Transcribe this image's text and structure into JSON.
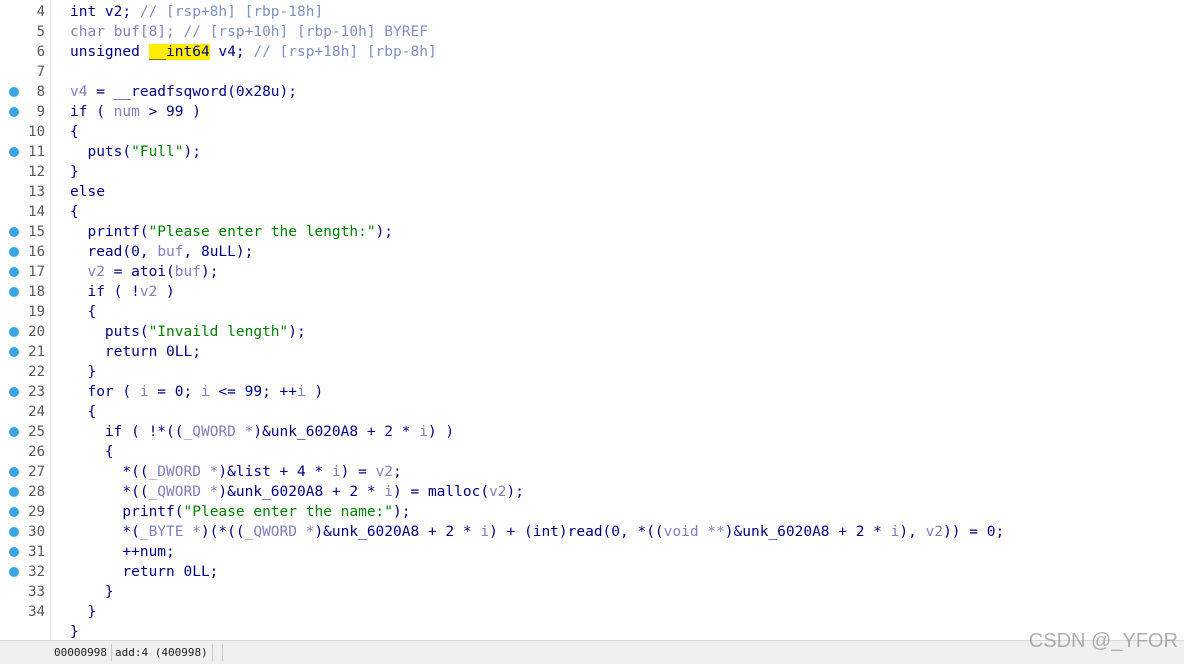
{
  "editor": {
    "lines": [
      {
        "num": "4",
        "bp": false,
        "segs": [
          [
            "int v2; ",
            ""
          ],
          [
            "// [rsp+8h] [rbp-18h]",
            "s-c"
          ]
        ]
      },
      {
        "num": "5",
        "bp": false,
        "segs": [
          [
            "char buf[8]; ",
            "s-v"
          ],
          [
            "// [rsp+10h] [rbp-10h] BYREF",
            "s-c"
          ]
        ]
      },
      {
        "num": "6",
        "bp": false,
        "segs": [
          [
            "unsigned ",
            ""
          ],
          [
            "__int64",
            "s-hl"
          ],
          [
            " v4; ",
            ""
          ],
          [
            "// [rsp+18h] [rbp-8h]",
            "s-c"
          ]
        ]
      },
      {
        "num": "7",
        "bp": false,
        "segs": []
      },
      {
        "num": "8",
        "bp": true,
        "segs": [
          [
            "v4",
            "s-v"
          ],
          [
            " = __readfsqword(0x28u);",
            ""
          ]
        ]
      },
      {
        "num": "9",
        "bp": true,
        "segs": [
          [
            "if ( ",
            ""
          ],
          [
            "num",
            "s-v"
          ],
          [
            " > 99 )",
            ""
          ]
        ]
      },
      {
        "num": "10",
        "bp": false,
        "segs": [
          [
            "{",
            ""
          ]
        ]
      },
      {
        "num": "11",
        "bp": true,
        "segs": [
          [
            "  puts(",
            ""
          ],
          [
            "\"Full\"",
            "s-s"
          ],
          [
            ");",
            ""
          ]
        ]
      },
      {
        "num": "12",
        "bp": false,
        "segs": [
          [
            "}",
            ""
          ]
        ]
      },
      {
        "num": "13",
        "bp": false,
        "segs": [
          [
            "else",
            ""
          ]
        ]
      },
      {
        "num": "14",
        "bp": false,
        "segs": [
          [
            "{",
            ""
          ]
        ]
      },
      {
        "num": "15",
        "bp": true,
        "segs": [
          [
            "  printf(",
            ""
          ],
          [
            "\"Please enter the length:\"",
            "s-s"
          ],
          [
            ");",
            ""
          ]
        ]
      },
      {
        "num": "16",
        "bp": true,
        "segs": [
          [
            "  read(0, ",
            ""
          ],
          [
            "buf",
            "s-v"
          ],
          [
            ", 8uLL);",
            ""
          ]
        ]
      },
      {
        "num": "17",
        "bp": true,
        "segs": [
          [
            "  ",
            ""
          ],
          [
            "v2",
            "s-v"
          ],
          [
            " = atoi(",
            ""
          ],
          [
            "buf",
            "s-v"
          ],
          [
            ");",
            ""
          ]
        ]
      },
      {
        "num": "18",
        "bp": true,
        "segs": [
          [
            "  if ( !",
            ""
          ],
          [
            "v2",
            "s-v"
          ],
          [
            " )",
            ""
          ]
        ]
      },
      {
        "num": "19",
        "bp": false,
        "segs": [
          [
            "  {",
            ""
          ]
        ]
      },
      {
        "num": "20",
        "bp": true,
        "segs": [
          [
            "    puts(",
            ""
          ],
          [
            "\"Invaild length\"",
            "s-s"
          ],
          [
            ");",
            ""
          ]
        ]
      },
      {
        "num": "21",
        "bp": true,
        "segs": [
          [
            "    return 0LL;",
            ""
          ]
        ]
      },
      {
        "num": "22",
        "bp": false,
        "segs": [
          [
            "  }",
            ""
          ]
        ]
      },
      {
        "num": "23",
        "bp": true,
        "segs": [
          [
            "  for ( ",
            ""
          ],
          [
            "i",
            "s-v"
          ],
          [
            " = 0; ",
            ""
          ],
          [
            "i",
            "s-v"
          ],
          [
            " <= 99; ++",
            ""
          ],
          [
            "i",
            "s-v"
          ],
          [
            " )",
            ""
          ]
        ]
      },
      {
        "num": "24",
        "bp": false,
        "segs": [
          [
            "  {",
            ""
          ]
        ]
      },
      {
        "num": "25",
        "bp": true,
        "segs": [
          [
            "    if ( !*((",
            ""
          ],
          [
            "_QWORD *",
            "s-v"
          ],
          [
            ")&unk_6020A8 + 2 * ",
            ""
          ],
          [
            "i",
            "s-v"
          ],
          [
            ") )",
            ""
          ]
        ]
      },
      {
        "num": "26",
        "bp": false,
        "segs": [
          [
            "    {",
            ""
          ]
        ]
      },
      {
        "num": "27",
        "bp": true,
        "segs": [
          [
            "      *((",
            ""
          ],
          [
            "_DWORD *",
            "s-v"
          ],
          [
            ")&list + 4 * ",
            ""
          ],
          [
            "i",
            "s-v"
          ],
          [
            ") = ",
            ""
          ],
          [
            "v2",
            "s-v"
          ],
          [
            ";",
            ""
          ]
        ]
      },
      {
        "num": "28",
        "bp": true,
        "segs": [
          [
            "      *((",
            ""
          ],
          [
            "_QWORD *",
            "s-v"
          ],
          [
            ")&unk_6020A8 + 2 * ",
            ""
          ],
          [
            "i",
            "s-v"
          ],
          [
            ") = malloc(",
            ""
          ],
          [
            "v2",
            "s-v"
          ],
          [
            ");",
            ""
          ]
        ]
      },
      {
        "num": "29",
        "bp": true,
        "segs": [
          [
            "      printf(",
            ""
          ],
          [
            "\"Please enter the name:\"",
            "s-s"
          ],
          [
            ");",
            ""
          ]
        ]
      },
      {
        "num": "30",
        "bp": true,
        "segs": [
          [
            "      *(",
            ""
          ],
          [
            "_BYTE *",
            "s-v"
          ],
          [
            ")(*((",
            ""
          ],
          [
            "_QWORD *",
            "s-v"
          ],
          [
            ")&unk_6020A8 + 2 * ",
            ""
          ],
          [
            "i",
            "s-v"
          ],
          [
            ") + (int)read(0, *((",
            ""
          ],
          [
            "void **",
            "s-v"
          ],
          [
            ")&unk_6020A8 + 2 * ",
            ""
          ],
          [
            "i",
            "s-v"
          ],
          [
            "), ",
            ""
          ],
          [
            "v2",
            "s-v"
          ],
          [
            ")) = 0;",
            ""
          ]
        ]
      },
      {
        "num": "31",
        "bp": true,
        "segs": [
          [
            "      ++num;",
            ""
          ]
        ]
      },
      {
        "num": "32",
        "bp": true,
        "segs": [
          [
            "      return 0LL;",
            ""
          ]
        ]
      },
      {
        "num": "33",
        "bp": false,
        "segs": [
          [
            "    }",
            ""
          ]
        ]
      },
      {
        "num": "34",
        "bp": false,
        "segs": [
          [
            "  }",
            ""
          ]
        ]
      },
      {
        "num": "",
        "bp": false,
        "segs": [
          [
            "}",
            ""
          ]
        ]
      }
    ]
  },
  "status_bar": {
    "offset": "00000998",
    "location": "add:4 (400998)"
  },
  "watermark": "CSDN @_YFOR",
  "colors": {
    "keyword": "#000080",
    "variable": "#8080c0",
    "comment": "#8090c0",
    "string": "#008000",
    "highlight": "#ffee00",
    "breakpoint": "#3aa3e3"
  }
}
